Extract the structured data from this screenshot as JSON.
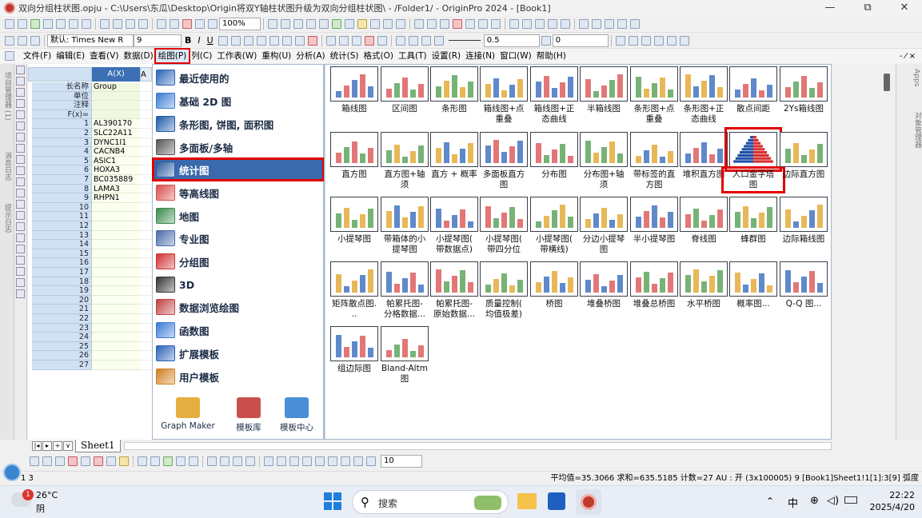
{
  "window": {
    "title": "双向分组柱状图.opju - C:\\Users\\东瓜\\Desktop\\Origin将双Y轴柱状图升级为双向分组柱状图\\ - /Folder1/ - OriginPro 2024 - [Book1]",
    "minimize": "—",
    "restore": "⧉",
    "close": "✕"
  },
  "toolbar": {
    "zoom": "100%",
    "font_label": "默认: Times New R",
    "font_size": "9",
    "bold": "B",
    "italic": "I",
    "underline": "U",
    "line_width": "0.5",
    "value_zero": "0",
    "bottom_value": "10"
  },
  "menu": [
    "文件(F)",
    "编辑(E)",
    "查看(V)",
    "数据(D)",
    "绘图(P)",
    "列(C)",
    "工作表(W)",
    "重构(U)",
    "分析(A)",
    "统计(S)",
    "格式(O)",
    "工具(T)",
    "设置(R)",
    "连接(N)",
    "窗口(W)",
    "帮助(H)"
  ],
  "menu_close": "- ⁄ ×",
  "sheet": {
    "col_a": "A(X)",
    "col_b": "A",
    "meta_rows": [
      {
        "label": "长名称",
        "value": "Group"
      },
      {
        "label": "单位",
        "value": ""
      },
      {
        "label": "注释",
        "value": ""
      },
      {
        "label": "F(x)=",
        "value": ""
      }
    ],
    "rows": [
      "AL390170",
      "SLC22A11",
      "DYNC1I1",
      "CACNB4",
      "ASIC1",
      "HOXA3",
      "BC035889",
      "LAMA3",
      "RHPN1",
      "",
      "",
      "",
      "",
      "",
      "",
      "",
      "",
      "",
      "",
      "",
      "",
      "",
      "",
      "",
      "",
      "",
      ""
    ],
    "tab": "Sheet1"
  },
  "categories": [
    {
      "label": "最近使用的",
      "icon": "recent-icon",
      "color": "#2a62b8"
    },
    {
      "label": "基础 2D 图",
      "icon": "line-2d-icon",
      "color": "#3a7bd5"
    },
    {
      "label": "条形图, 饼图, 面积图",
      "icon": "bar-chart-icon",
      "color": "#1e5aa8"
    },
    {
      "label": "多面板/多轴",
      "icon": "multi-panel-icon",
      "color": "#555555"
    },
    {
      "label": "统计图",
      "icon": "statistics-icon",
      "color": "#2b5aa0"
    },
    {
      "label": "等高线图",
      "icon": "contour-icon",
      "color": "#d94a4a"
    },
    {
      "label": "地图",
      "icon": "map-icon",
      "color": "#3a8a4a"
    },
    {
      "label": "专业图",
      "icon": "pentagon-icon",
      "color": "#4a6aaa"
    },
    {
      "label": "分组图",
      "icon": "grouped-scatter-icon",
      "color": "#d03030"
    },
    {
      "label": "3D",
      "icon": "3d-icon",
      "color": "#333333"
    },
    {
      "label": "数据浏览绘图",
      "icon": "data-explore-icon",
      "color": "#c04040"
    },
    {
      "label": "函数图",
      "icon": "function-icon",
      "color": "#3a7bd5"
    },
    {
      "label": "扩展模板",
      "icon": "extension-icon",
      "color": "#2a62b8"
    },
    {
      "label": "用户模板",
      "icon": "user-template-icon",
      "color": "#d08020"
    }
  ],
  "bottom_buttons": [
    {
      "label": "Graph Maker",
      "icon": "graph-maker-icon",
      "color": "#e0a020"
    },
    {
      "label": "模板库",
      "icon": "template-library-icon",
      "color": "#c03030"
    },
    {
      "label": "模板中心",
      "icon": "cloud-download-icon",
      "color": "#2a7ad0"
    }
  ],
  "graphs": [
    [
      "箱线图",
      "区间图",
      "条形图",
      "箱线图+点\n重叠",
      "箱线图+正\n态曲线",
      "半箱线图",
      "条形图+点\n重叠",
      "条形图+正\n态曲线",
      "散点间距",
      "2Ys箱线图"
    ],
    [
      "直方图",
      "直方图+轴\n须",
      "直方 + 概率",
      "多面板直方\n图",
      "分布图",
      "分布图+轴\n须",
      "带标签的直\n方图",
      "堆积直方图",
      "人口金字塔\n图",
      "边际直方图"
    ],
    [
      "小提琴图",
      "带箱体的小\n提琴图",
      "小提琴图(\n带数据点)",
      "小提琴图(\n带四分位",
      "小提琴图(\n带横线)",
      "分边小提琴\n图",
      "半小提琴图",
      "脊线图",
      "蜂群图",
      "边际箱线图"
    ],
    [
      "矩阵散点图.\n..",
      "帕累托图-\n分格数据...",
      "帕累托图-\n原始数据...",
      "质量控制(\n均值极差)",
      "桥图",
      "堆叠桥图",
      "堆叠总桥图",
      "水平桥图",
      "概率图...",
      "Q-Q 图..."
    ],
    [
      "组边际图",
      "Bland-Altm\n图"
    ]
  ],
  "status": {
    "left": "1 3",
    "right": "平均值=35.3066 求和=635.5185 计数=27   AU : 开   (3x100005) 9   [Book1]Sheet1!1[1]:3[9]   弧度"
  },
  "taskbar": {
    "weather_temp": "26°C",
    "weather_desc": "阴",
    "weather_badge": "1",
    "search": "搜索",
    "ime": "中",
    "time": "22:22",
    "date": "2025/4/20"
  }
}
